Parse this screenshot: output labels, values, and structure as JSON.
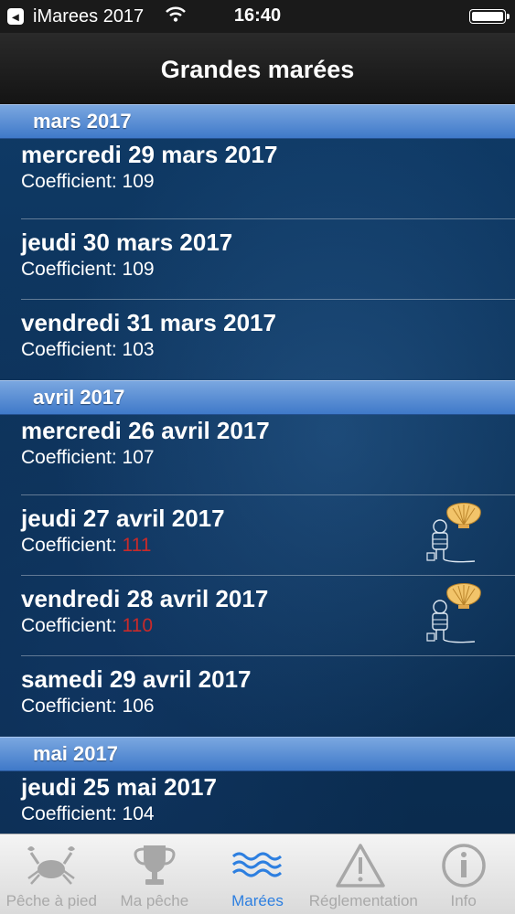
{
  "status_bar": {
    "app_name": "iMarees 2017",
    "time": "16:40",
    "back_glyph": "◂"
  },
  "nav": {
    "title": "Grandes marées"
  },
  "coefficient_label": "Coefficient:",
  "sections": [
    {
      "header": "mars 2017",
      "rows": [
        {
          "day": "mercredi 29 mars 2017",
          "value": "109",
          "high": false
        },
        {
          "day": "jeudi 30 mars 2017",
          "value": "109",
          "high": false
        },
        {
          "day": "vendredi 31 mars 2017",
          "value": "103",
          "high": false
        }
      ]
    },
    {
      "header": "avril 2017",
      "rows": [
        {
          "day": "mercredi 26 avril 2017",
          "value": "107",
          "high": false
        },
        {
          "day": "jeudi 27 avril 2017",
          "value": "111",
          "high": true
        },
        {
          "day": "vendredi 28 avril 2017",
          "value": "110",
          "high": true
        },
        {
          "day": "samedi 29 avril 2017",
          "value": "106",
          "high": false
        }
      ]
    },
    {
      "header": "mai 2017",
      "rows": [
        {
          "day": "jeudi 25 mai 2017",
          "value": "104",
          "high": false
        }
      ]
    }
  ],
  "tabs": [
    {
      "label": "Pêche à pied",
      "icon": "crab-icon"
    },
    {
      "label": "Ma pêche",
      "icon": "trophy-icon"
    },
    {
      "label": "Marées",
      "icon": "waves-icon",
      "active": true
    },
    {
      "label": "Réglementation",
      "icon": "warning-icon"
    },
    {
      "label": "Info",
      "icon": "info-icon"
    }
  ],
  "colors": {
    "accent": "#2d7fe0",
    "section_header": "#4f86d0",
    "high_coefficient": "#c82a2a"
  }
}
